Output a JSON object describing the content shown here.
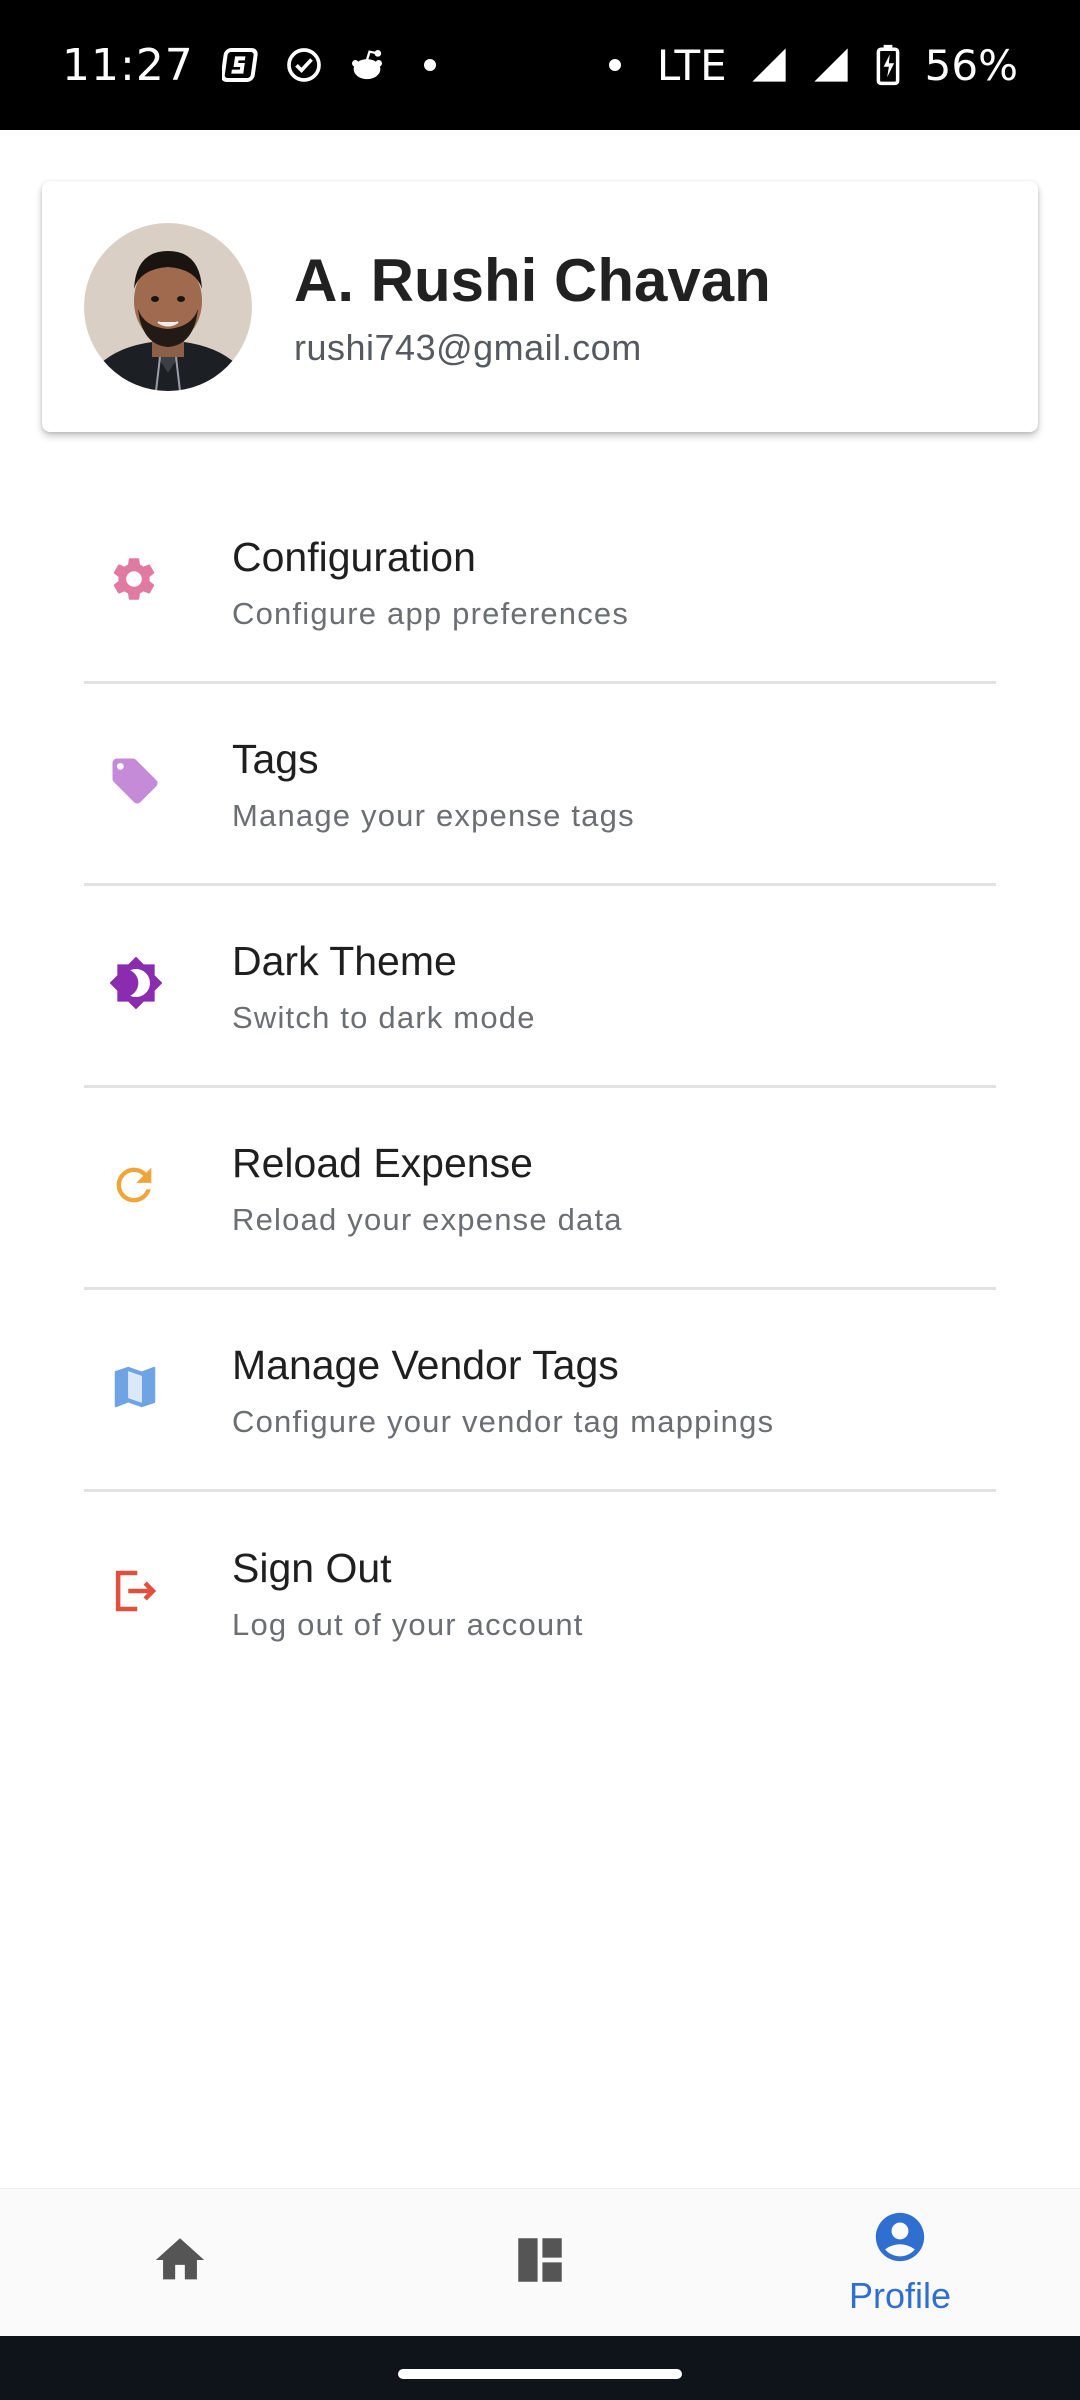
{
  "status_bar": {
    "time": "11:27",
    "network": "LTE",
    "battery": "56%"
  },
  "profile": {
    "name": "A. Rushi Chavan",
    "email": "rushi743@gmail.com"
  },
  "menu": [
    {
      "title": "Configuration",
      "subtitle": "Configure app preferences",
      "icon": "gear-icon",
      "color": "#e07aa0"
    },
    {
      "title": "Tags",
      "subtitle": "Manage your expense tags",
      "icon": "tag-icon",
      "color": "#c58bd8"
    },
    {
      "title": "Dark Theme",
      "subtitle": "Switch to dark mode",
      "icon": "brightness-icon",
      "color": "#8b2bb0"
    },
    {
      "title": "Reload Expense",
      "subtitle": "Reload your expense data",
      "icon": "refresh-icon",
      "color": "#f0a53a"
    },
    {
      "title": "Manage Vendor Tags",
      "subtitle": "Configure your vendor tag mappings",
      "icon": "map-icon",
      "color": "#6ea3e4"
    },
    {
      "title": "Sign Out",
      "subtitle": "Log out of your account",
      "icon": "logout-icon",
      "color": "#e0503c"
    }
  ],
  "bottom_nav": {
    "items": [
      {
        "icon": "home-icon",
        "label": "",
        "active": false
      },
      {
        "icon": "dashboard-icon",
        "label": "",
        "active": false
      },
      {
        "icon": "account-circle-icon",
        "label": "Profile",
        "active": true
      }
    ],
    "active_color": "#2f6fd0",
    "inactive_color": "#555555"
  }
}
